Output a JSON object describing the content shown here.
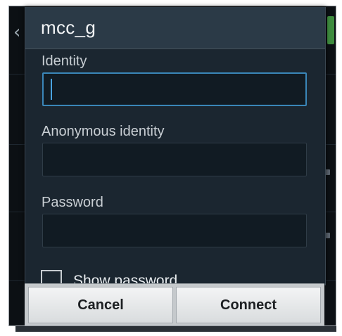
{
  "dialog": {
    "title": "mcc_g"
  },
  "fields": {
    "identity": {
      "label": "Identity",
      "value": ""
    },
    "anonymous_identity": {
      "label": "Anonymous identity",
      "value": ""
    },
    "password": {
      "label": "Password",
      "value": ""
    }
  },
  "show_password": {
    "label": "Show password",
    "checked": false
  },
  "buttons": {
    "cancel": "Cancel",
    "connect": "Connect"
  },
  "colors": {
    "dialog_bg": "#1b2630",
    "header_bg": "#2b3a47",
    "input_bg": "#111b23",
    "focus_accent": "#3a86b8",
    "button_bar_bg": "#c5c9cc"
  },
  "icons": {
    "back": "chevron-left-icon",
    "lock": "lock-icon"
  }
}
